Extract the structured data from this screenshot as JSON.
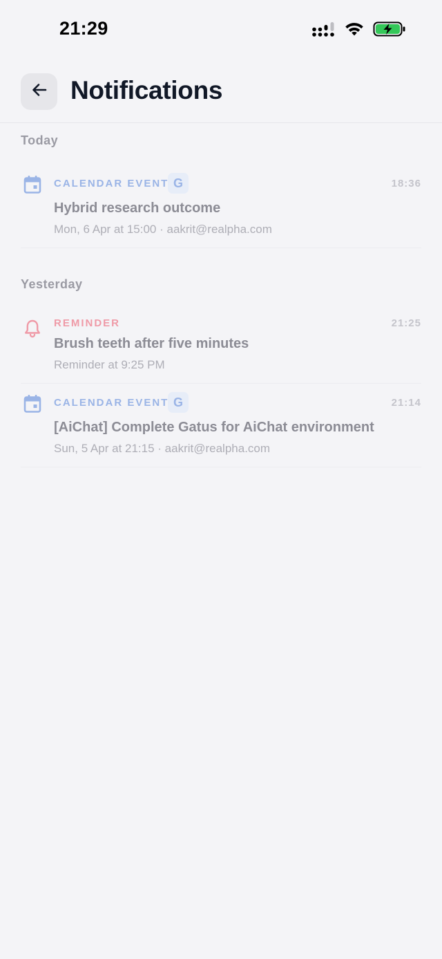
{
  "status_bar": {
    "time": "21:29",
    "icons": [
      "cellular-signal-icon",
      "wifi-icon",
      "battery-charging-icon"
    ]
  },
  "header": {
    "back_icon": "arrow-left-icon",
    "title": "Notifications"
  },
  "sections": [
    {
      "label": "Today",
      "items": [
        {
          "icon": "calendar-icon",
          "type_label": "CALENDAR EVENT",
          "badge": "G",
          "time": "18:36",
          "title": "Hybrid research outcome",
          "subtitle": "Mon, 6 Apr at 15:00 · aakrit@realpha.com"
        }
      ]
    },
    {
      "label": "Yesterday",
      "items": [
        {
          "icon": "bell-icon",
          "type_label": "REMINDER",
          "time": "21:25",
          "title": "Brush teeth after five minutes",
          "subtitle": "Reminder at 9:25 PM"
        },
        {
          "icon": "calendar-icon",
          "type_label": "CALENDAR EVENT",
          "badge": "G",
          "time": "21:14",
          "title": "[AiChat] Complete Gatus for AiChat environment",
          "subtitle": "Sun, 5 Apr at 21:15 · aakrit@realpha.com"
        }
      ]
    }
  ],
  "colors": {
    "background": "#f4f4f7",
    "calendar_accent": "#9ab4e6",
    "reminder_accent": "#ef9aa7",
    "title_text": "#111827"
  }
}
